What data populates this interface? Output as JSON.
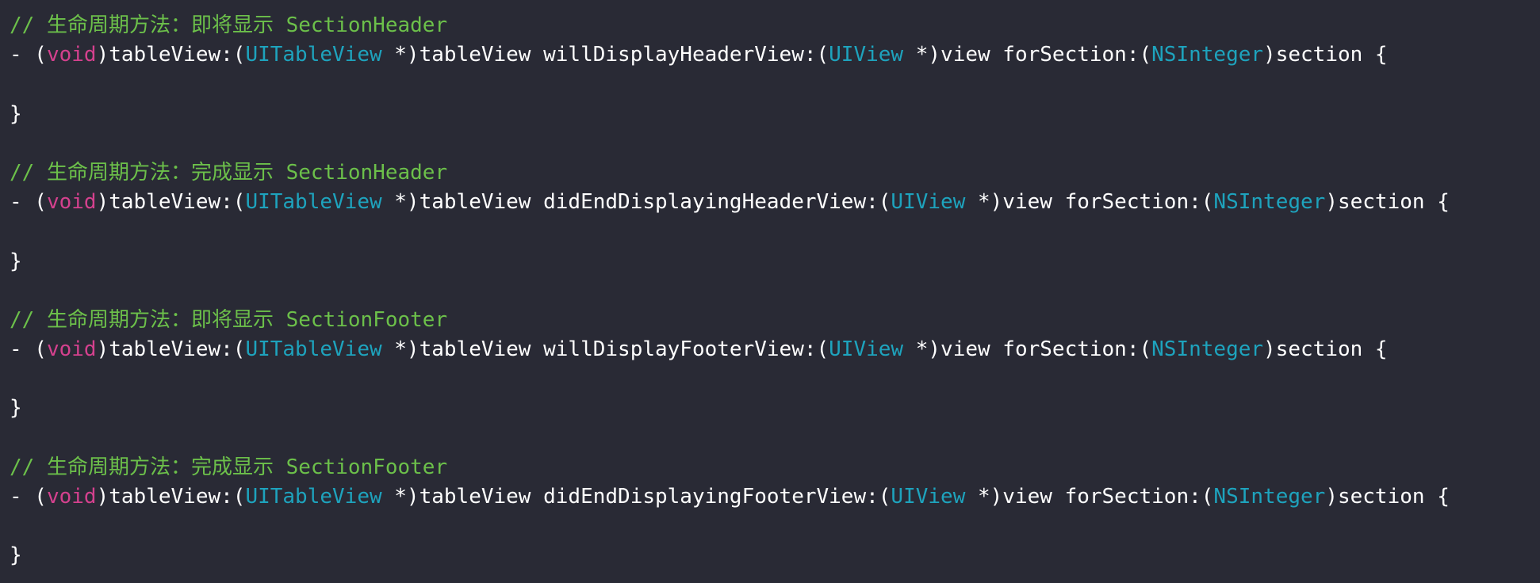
{
  "colors": {
    "background": "#292a35",
    "comment": "#6cc04a",
    "keyword": "#d4418e",
    "type": "#1ea3bd",
    "plain": "#ffffff"
  },
  "blocks": [
    {
      "comment": "// 生命周期方法：即将显示 SectionHeader",
      "method": "willDisplayHeaderView:",
      "close": "}"
    },
    {
      "comment": "// 生命周期方法：完成显示 SectionHeader",
      "method": "didEndDisplayingHeaderView:",
      "close": "}"
    },
    {
      "comment": "// 生命周期方法：即将显示 SectionFooter",
      "method": "willDisplayFooterView:",
      "close": "}"
    },
    {
      "comment": "// 生命周期方法：完成显示 SectionFooter",
      "method": "didEndDisplayingFooterView:",
      "close": "}"
    }
  ],
  "tokens": {
    "prefix": "- (",
    "void": "void",
    "tableView_sel": ")tableView:(",
    "uitableview": "UITableView",
    "star_tableView": " *)tableView ",
    "open_paren": "(",
    "uiview": "UIView",
    "star_view": " *)view forSection:(",
    "nsinteger": "NSInteger",
    "suffix": ")section {"
  }
}
